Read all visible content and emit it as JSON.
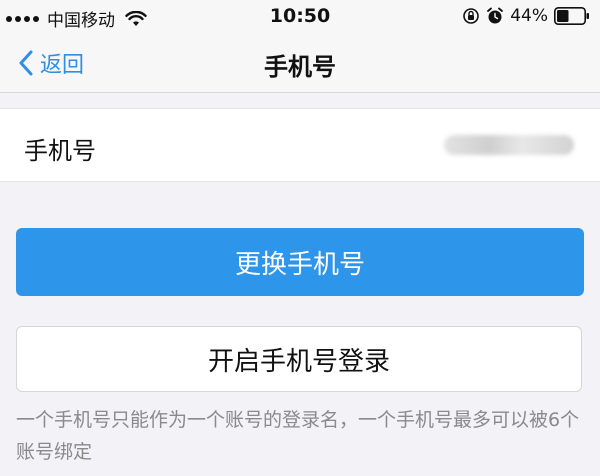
{
  "status_bar": {
    "carrier": "中国移动",
    "time": "10:50",
    "battery_percent": "44%",
    "battery_level": 0.44
  },
  "nav": {
    "back_label": "返回",
    "title": "手机号"
  },
  "phone_row": {
    "label": "手机号"
  },
  "buttons": {
    "change_phone": "更换手机号",
    "enable_phone_login": "开启手机号登录"
  },
  "footnote": "一个手机号只能作为一个账号的登录名，一个手机号最多可以被6个账号绑定",
  "colors": {
    "accent": "#2d95ea",
    "link": "#2f8fe4",
    "background": "#f2f2f7"
  }
}
